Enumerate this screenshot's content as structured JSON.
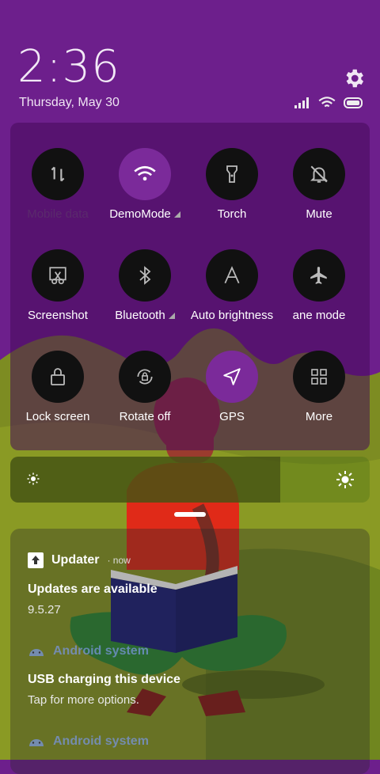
{
  "status": {
    "time": "2:36",
    "date": "Thursday, May 30"
  },
  "icons": {
    "settings": "gear-icon",
    "signal": "signal-icon",
    "wifi": "wifi-icon",
    "battery": "battery-icon"
  },
  "tiles": [
    {
      "label": "Mobile data",
      "icon": "data-arrows-icon",
      "active": false
    },
    {
      "label": "DemoMode",
      "icon": "wifi-icon",
      "active": true
    },
    {
      "label": "Torch",
      "icon": "torch-icon",
      "active": false
    },
    {
      "label": "Mute",
      "icon": "bell-off-icon",
      "active": false
    },
    {
      "label": "Screenshot",
      "icon": "scissors-icon",
      "active": false
    },
    {
      "label": "Bluetooth",
      "icon": "bluetooth-icon",
      "active": false
    },
    {
      "label": "Auto brightness",
      "icon": "letter-a-icon",
      "active": false
    },
    {
      "label": "ane mode",
      "icon": "airplane-icon",
      "active": false
    },
    {
      "label": "Lock screen",
      "icon": "lock-icon",
      "active": false
    },
    {
      "label": "Rotate off",
      "icon": "rotate-lock-icon",
      "active": false
    },
    {
      "label": "GPS",
      "icon": "navigation-icon",
      "active": true
    },
    {
      "label": "More",
      "icon": "grid-icon",
      "active": false
    }
  ],
  "brightness": {
    "level": 0.75
  },
  "notifications": [
    {
      "app": "Updater",
      "time": "now",
      "title": "Updates are available",
      "body": "9.5.27"
    },
    {
      "app": "Android system",
      "title": "USB charging this device",
      "body": "Tap for more options."
    },
    {
      "app": "Android system"
    }
  ],
  "colors": {
    "accent": "#7b2a9a",
    "background": "#6d1f8c",
    "tile": "#111111"
  }
}
